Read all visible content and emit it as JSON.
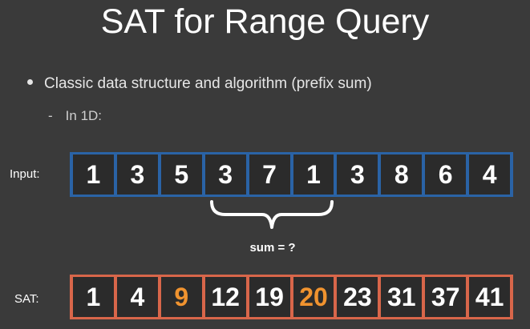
{
  "title": "SAT for Range Query",
  "bullet": "Classic data structure and algorithm (prefix sum)",
  "sub_bullet": {
    "dash": "-",
    "text": "In 1D:"
  },
  "input": {
    "label": "Input:",
    "values": [
      "1",
      "3",
      "5",
      "3",
      "7",
      "1",
      "3",
      "8",
      "6",
      "4"
    ]
  },
  "brace_label": "sum = ?",
  "sat": {
    "label": "SAT:",
    "values": [
      "1",
      "4",
      "9",
      "12",
      "19",
      "20",
      "23",
      "31",
      "37",
      "41"
    ],
    "highlighted_indices": [
      2,
      5
    ]
  },
  "colors": {
    "background": "#3a3a3a",
    "input_border": "#2a63a6",
    "sat_border": "#d8664a",
    "highlight": "#f0932f"
  }
}
